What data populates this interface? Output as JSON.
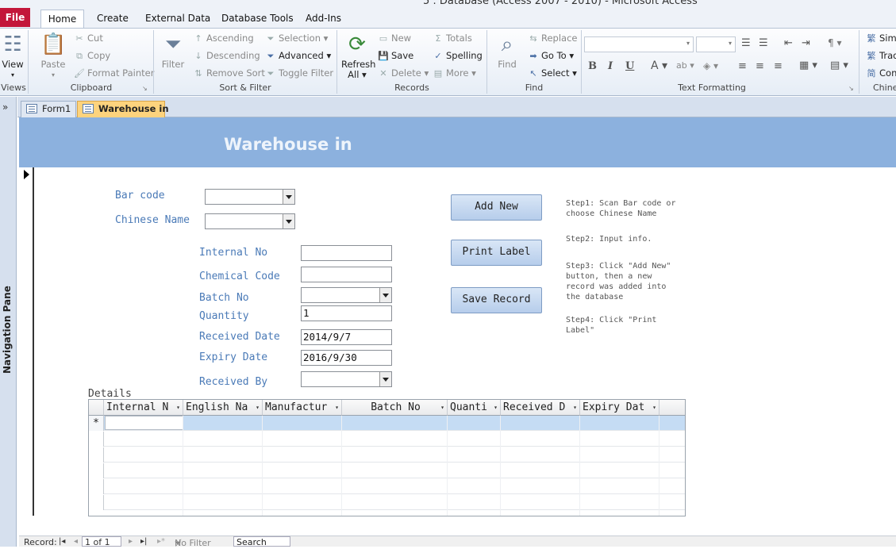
{
  "window": {
    "title": "5 : Database (Access 2007 - 2010)  -  Microsoft Access"
  },
  "ribbon_tabs": {
    "file": "File",
    "home": "Home",
    "create": "Create",
    "external_data": "External Data",
    "database_tools": "Database Tools",
    "add_ins": "Add-Ins"
  },
  "views": {
    "view": "View",
    "label": "Views"
  },
  "clipboard": {
    "paste": "Paste",
    "cut": "Cut",
    "copy": "Copy",
    "format_painter": "Format Painter",
    "label": "Clipboard"
  },
  "sort_filter": {
    "filter": "Filter",
    "ascending": "Ascending",
    "descending": "Descending",
    "remove_sort": "Remove Sort",
    "selection": "Selection",
    "advanced": "Advanced",
    "toggle_filter": "Toggle Filter",
    "label": "Sort & Filter"
  },
  "records": {
    "refresh": "Refresh",
    "refresh_all": "All",
    "new": "New",
    "save": "Save",
    "delete": "Delete",
    "totals": "Totals",
    "spelling": "Spelling",
    "more": "More",
    "label": "Records"
  },
  "find": {
    "find": "Find",
    "replace": "Replace",
    "go_to": "Go To",
    "select": "Select",
    "label": "Find"
  },
  "text_formatting": {
    "bold": "B",
    "italic": "I",
    "underline": "U",
    "label": "Text Formatting"
  },
  "chinese_conversion": {
    "simplified": "Sim",
    "traditional": "Trad",
    "convert": "Con",
    "label": "Chine"
  },
  "nav_pane": {
    "chevron": "»",
    "label": "Navigation Pane"
  },
  "doc_tabs": [
    {
      "label": "Form1"
    },
    {
      "label": "Warehouse in"
    }
  ],
  "form": {
    "title": "Warehouse in",
    "bar_code_label": "Bar code",
    "chinese_name_label": "Chinese Name",
    "internal_no_label": "Internal No",
    "chemical_code_label": "Chemical Code",
    "batch_no_label": "Batch No",
    "quantity_label": "Quantity",
    "quantity_value": "1",
    "received_date_label": "Received Date",
    "received_date_value": "2014/9/7",
    "expiry_date_label": "Expiry Date",
    "expiry_date_value": "2016/9/30",
    "received_by_label": "Received By",
    "add_new": "Add New",
    "print_label": "Print Label",
    "save_record": "Save Record",
    "step1": "Step1: Scan Bar code or\nchoose Chinese Name",
    "step2": "Step2: Input info.",
    "step3": "Step3: Click \"Add New\"\nbutton, then a new\nrecord was added into\nthe database",
    "step4": "Step4: Click \"Print\nLabel\"",
    "details_label": "Details"
  },
  "details_grid": {
    "columns": [
      "Internal N",
      "English Na",
      "Manufactur",
      "Batch No",
      "Quanti",
      "Received D",
      "Expiry Dat"
    ],
    "new_row_marker": "*"
  },
  "statusbar": {
    "record_label": "Record:",
    "first": "|◂",
    "prev": "◂",
    "position": "1 of 1",
    "next": "▸",
    "last": "▸|",
    "no_filter": "No Filter",
    "search": "Search"
  }
}
